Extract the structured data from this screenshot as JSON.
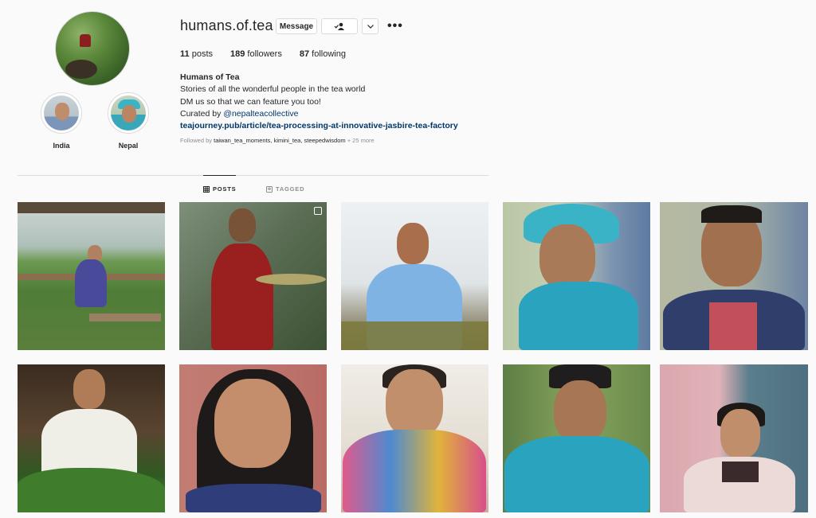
{
  "profile": {
    "username": "humans.of.tea",
    "message_label": "Message",
    "more_label": "•••",
    "stats": {
      "posts": "11",
      "posts_label": "posts",
      "followers": "189",
      "followers_label": "followers",
      "following": "87",
      "following_label": "following"
    },
    "bio": {
      "name": "Humans of Tea",
      "line1": "Stories of all the wonderful people in the tea world",
      "line2": "DM us so that we can feature you too!",
      "curated_prefix": "Curated by ",
      "curated_mention": "@nepalteacollective",
      "link": "teajourney.pub/article/tea-processing-at-innovative-jasbire-tea-factory"
    },
    "followed_by": {
      "prefix": "Followed by ",
      "names": "taiwan_tea_moments, kimini_tea, steepedwisdom",
      "suffix": " + 25 more"
    }
  },
  "highlights": [
    {
      "label": "India"
    },
    {
      "label": "Nepal"
    }
  ],
  "tabs": [
    {
      "label": "POSTS",
      "active": true
    },
    {
      "label": "TAGGED",
      "active": false
    }
  ],
  "colors": {
    "background": "#fafafa",
    "text": "#262626",
    "link": "#00376b",
    "muted": "#8e8e8e",
    "border": "#dbdbdb"
  }
}
